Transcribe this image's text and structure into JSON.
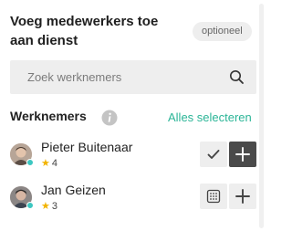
{
  "header": {
    "title": "Voeg medewerkers toe aan dienst",
    "badge": "optioneel"
  },
  "search": {
    "placeholder": "Zoek werknemers",
    "value": ""
  },
  "section": {
    "title": "Werknemers",
    "select_all": "Alles selecteren"
  },
  "employees": [
    {
      "name": "Pieter Buitenaar",
      "rating": "4",
      "selected": true
    },
    {
      "name": "Jan Geizen",
      "rating": "3",
      "selected": false
    }
  ],
  "colors": {
    "accent": "#2bb597",
    "presence": "#3cc7c1",
    "star": "#f2b300",
    "button_dark": "#4a4a4a",
    "button_light": "#eeeeee"
  },
  "icons": {
    "search": "search-icon",
    "info": "info-icon",
    "check": "check-icon",
    "plus": "plus-icon",
    "calendar": "calendar-grid-icon",
    "star": "star-icon"
  }
}
